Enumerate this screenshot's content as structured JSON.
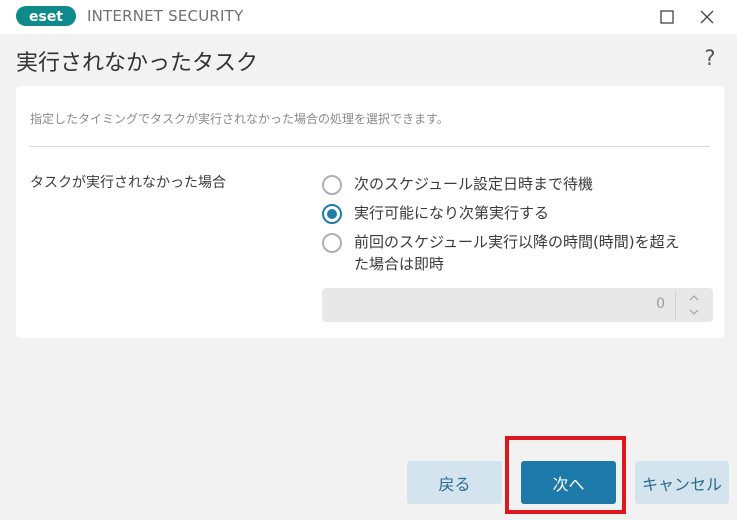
{
  "app": {
    "logo_text": "eset",
    "product_name": "INTERNET SECURITY"
  },
  "window_controls": {
    "maximize": "maximize-icon",
    "close": "close-icon"
  },
  "header": {
    "title": "実行されなかったタスク",
    "help": "?"
  },
  "panel": {
    "description": "指定したタイミングでタスクが実行されなかった場合の処理を選択できます。",
    "field_label": "タスクが実行されなかった場合",
    "options": [
      {
        "label": "次のスケジュール設定日時まで待機",
        "checked": false
      },
      {
        "label": "実行可能になり次第実行する",
        "checked": true
      },
      {
        "label": "前回のスケジュール実行以降の時間(時間)を超えた場合は即時",
        "checked": false
      }
    ],
    "hours_value": "0"
  },
  "footer": {
    "back_label": "戻る",
    "next_label": "次へ",
    "cancel_label": "キャンセル"
  },
  "colors": {
    "accent": "#1d7aa8",
    "secondary_button": "#d4e4ee",
    "highlight": "#e0161d"
  }
}
